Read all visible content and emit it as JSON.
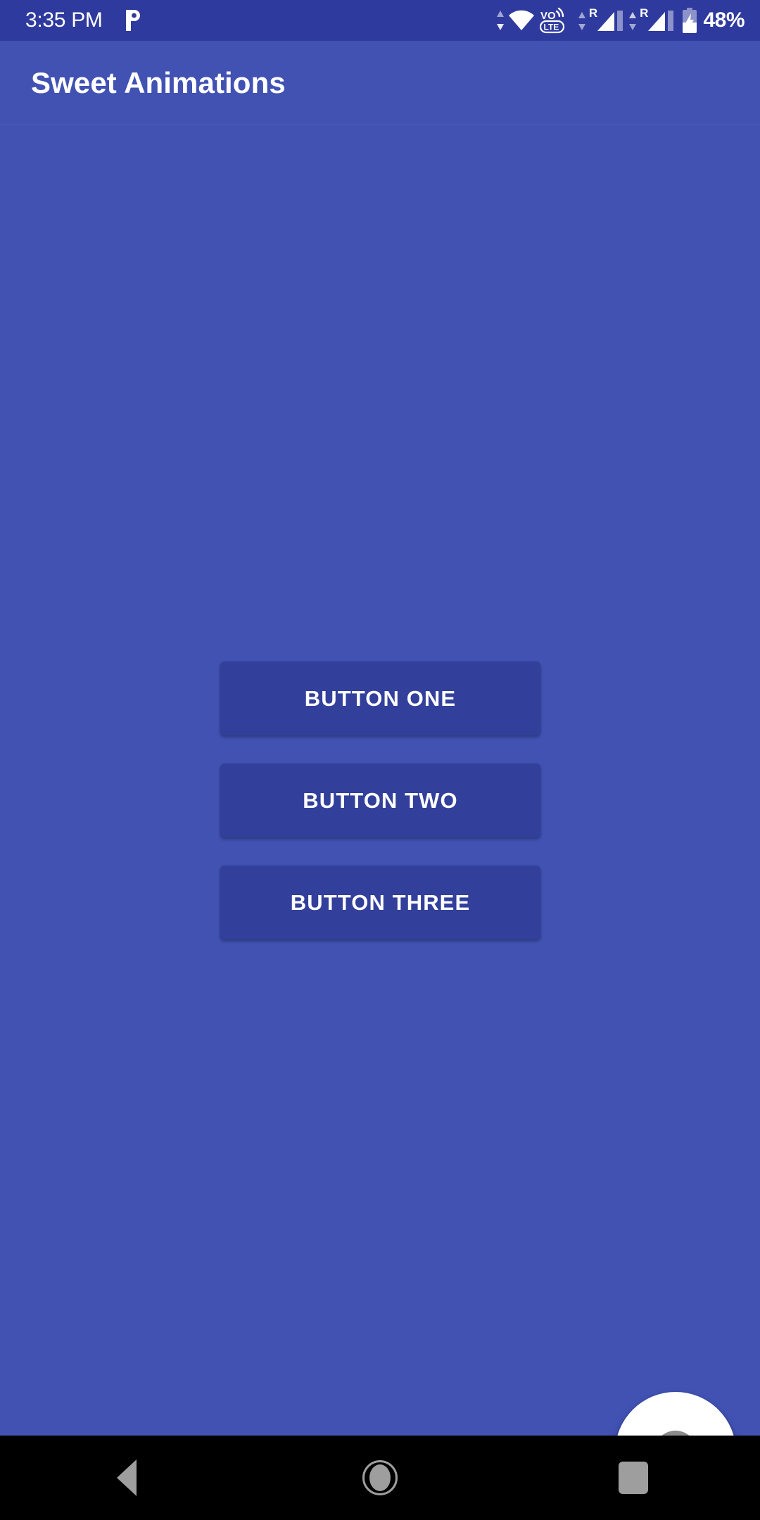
{
  "status_bar": {
    "time": "3:35 PM",
    "notification_icons": [
      "pandora-p-icon"
    ],
    "wifi_icon": "wifi-icon",
    "data_arrows_icon": "data-transfer-arrows-icon",
    "volte_label_top": "VO",
    "volte_label_bottom": "LTE",
    "sim_slots": [
      {
        "roaming_label": "R",
        "signal_icon": "cellular-signal-icon"
      },
      {
        "roaming_label": "R",
        "signal_icon": "cellular-signal-icon"
      }
    ],
    "battery_icon": "battery-charging-icon",
    "battery_percent": "48%",
    "background_color": "#2e3a9e",
    "foreground_color": "#ffffff"
  },
  "app_bar": {
    "title": "Sweet Animations",
    "background_color": "#4152b3",
    "title_color": "#ffffff"
  },
  "main": {
    "background_color": "#4152b3",
    "buttons": [
      {
        "label": "BUTTON ONE",
        "name": "button-one"
      },
      {
        "label": "BUTTON TWO",
        "name": "button-two"
      },
      {
        "label": "BUTTON THREE",
        "name": "button-three"
      }
    ],
    "button_color": "#323f9b",
    "button_text_color": "#ffffff"
  },
  "fab": {
    "icon": "close-circle-icon",
    "background_color": "#ffffff",
    "glyph_color": "#8a8a8a",
    "glyph_mark_color": "#ffffff"
  },
  "nav_bar": {
    "background_color": "#000000",
    "icon_color": "#9e9e9e",
    "items": [
      {
        "name": "nav-back-button",
        "icon": "triangle-back-icon"
      },
      {
        "name": "nav-home-button",
        "icon": "circle-home-icon"
      },
      {
        "name": "nav-recents-button",
        "icon": "square-recents-icon"
      }
    ]
  }
}
